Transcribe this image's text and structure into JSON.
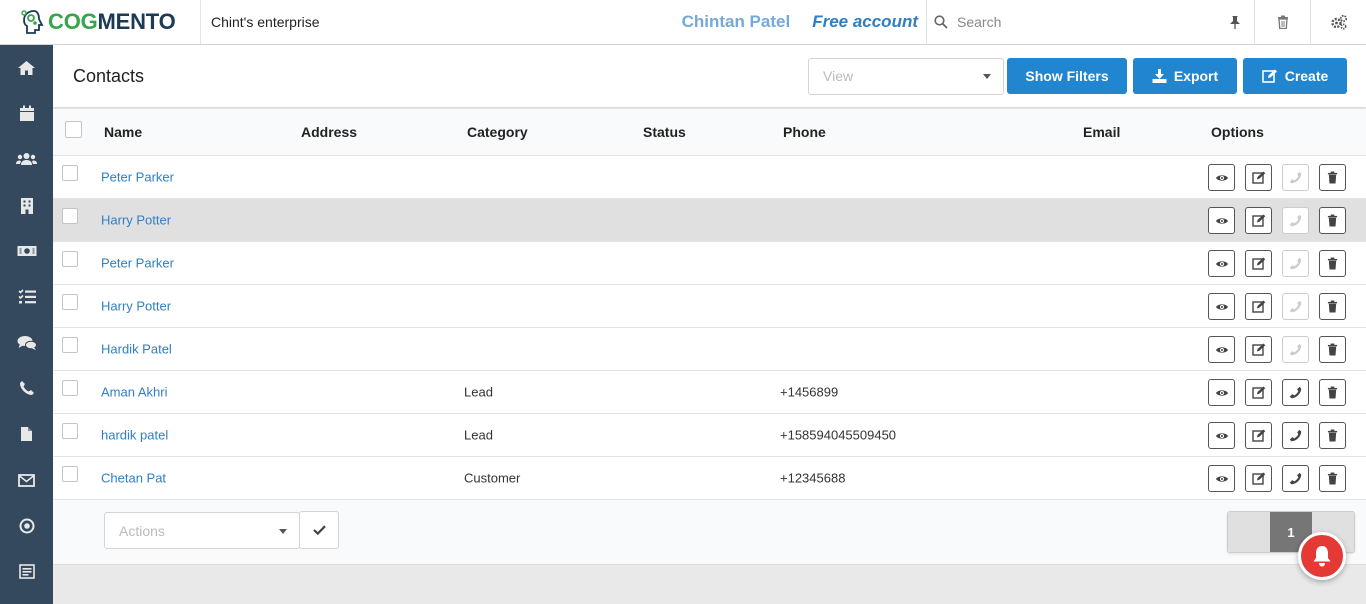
{
  "app": {
    "logo_cog": "COG",
    "logo_mento": "MENTO",
    "organization": "Chint's enterprise",
    "user_name": "Chintan Patel",
    "account_type": "Free account",
    "search_placeholder": "Search"
  },
  "sidebar": {
    "items": [
      "home-icon",
      "calendar-icon",
      "contacts-icon",
      "companies-icon",
      "deals-icon",
      "tasks-icon",
      "cases-icon",
      "calls-icon",
      "documents-icon",
      "email-icon",
      "campaigns-icon",
      "forms-icon"
    ]
  },
  "page": {
    "title": "Contacts",
    "view_placeholder": "View",
    "show_filters_label": "Show Filters",
    "export_label": "Export",
    "create_label": "Create"
  },
  "table": {
    "columns": {
      "name": "Name",
      "address": "Address",
      "category": "Category",
      "status": "Status",
      "phone": "Phone",
      "email": "Email",
      "options": "Options"
    },
    "rows": [
      {
        "name": "Peter Parker",
        "address": "",
        "category": "",
        "status": "",
        "phone": "",
        "email": ""
      },
      {
        "name": "Harry Potter",
        "address": "",
        "category": "",
        "status": "",
        "phone": "",
        "email": ""
      },
      {
        "name": "Peter Parker",
        "address": "",
        "category": "",
        "status": "",
        "phone": "",
        "email": ""
      },
      {
        "name": "Harry Potter",
        "address": "",
        "category": "",
        "status": "",
        "phone": "",
        "email": ""
      },
      {
        "name": "Hardik Patel",
        "address": "",
        "category": "",
        "status": "",
        "phone": "",
        "email": ""
      },
      {
        "name": "Aman Akhri",
        "address": "",
        "category": "Lead",
        "status": "",
        "phone": "+1456899",
        "email": ""
      },
      {
        "name": "hardik patel",
        "address": "",
        "category": "Lead",
        "status": "",
        "phone": "+158594045509450",
        "email": ""
      },
      {
        "name": "Chetan Pat",
        "address": "",
        "category": "Customer",
        "status": "",
        "phone": "+12345688",
        "email": ""
      }
    ]
  },
  "footer": {
    "actions_placeholder": "Actions",
    "current_page": "1"
  },
  "colors": {
    "primary": "#2185d0",
    "sidebar": "#34495e",
    "link": "#2e7fc4",
    "notification": "#e53935"
  }
}
